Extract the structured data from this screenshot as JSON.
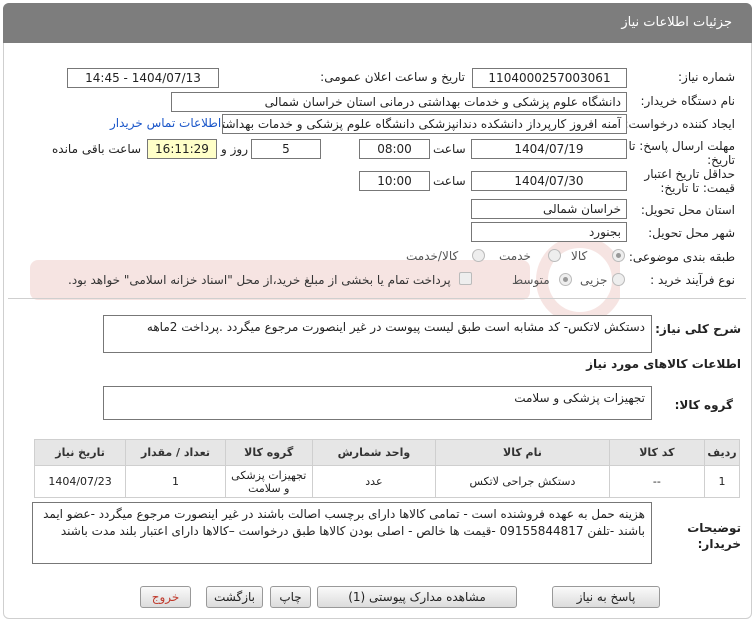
{
  "header": {
    "title": "جزئیات اطلاعات نیاز"
  },
  "fields": {
    "need_number_label": "شماره نیاز:",
    "need_number": "1104000257003061",
    "announce_label": "تاریخ و ساعت اعلان عمومی:",
    "announce_value": "1404/07/13 - 14:45",
    "buyer_org_label": "نام دستگاه خریدار:",
    "buyer_org": "دانشگاه علوم پزشکی و خدمات بهداشتی درمانی استان خراسان شمالی",
    "requester_label": "ایجاد کننده درخواست:",
    "requester": "آمنه افروز کارپرداز دانشکده دندانپزشکی دانشگاه علوم پزشکی و خدمات بهداشتی",
    "contact_link": "اطلاعات تماس خریدار",
    "deadline_label": "مهلت ارسال پاسخ: تا تاریخ:",
    "deadline_date": "1404/07/19",
    "time_label": "ساعت",
    "deadline_time": "08:00",
    "days_count": "5",
    "days_label": "روز و",
    "remaining_time": "16:11:29",
    "remaining_label": "ساعت باقی مانده",
    "validity_label": "حداقل تاریخ اعتبار قیمت: تا تاریخ:",
    "validity_date": "1404/07/30",
    "validity_time": "10:00",
    "province_label": "استان محل تحویل:",
    "province": "خراسان شمالی",
    "city_label": "شهر محل تحویل:",
    "city": "بجنورد",
    "category_label": "طبقه بندی موضوعی:",
    "category_options": [
      "کالا",
      "خدمت",
      "کالا/خدمت"
    ],
    "category_selected": "کالا",
    "process_label": "نوع فرآیند خرید :",
    "process_options": [
      "جزیی",
      "متوسط"
    ],
    "payment_note": "پرداخت تمام یا بخشی از مبلغ خرید،از محل \"اسناد خزانه اسلامی\" خواهد بود."
  },
  "description": {
    "label": "شرح کلی نیاز:",
    "text": "دستکش لاتکس- کد مشابه است طبق لیست پیوست در غیر اینصورت مرجوع میگردد .پرداخت 2ماهه"
  },
  "goods": {
    "section_title": "اطلاعات کالاهای مورد نیاز",
    "group_label": "گروه کالا:",
    "group_value": "تجهیزات پزشکی و سلامت"
  },
  "table": {
    "headers": [
      "ردیف",
      "کد کالا",
      "نام کالا",
      "واحد شمارش",
      "گروه کالا",
      "تعداد / مقدار",
      "تاریخ نیاز"
    ],
    "rows": [
      [
        "1",
        "--",
        "دستکش جراحی لاتکس",
        "عدد",
        "تجهیزات پزشکی و سلامت",
        "1",
        "1404/07/23"
      ]
    ]
  },
  "buyer_notes": {
    "label": "توضیحات خریدار:",
    "text": "هزینه حمل به عهده فروشنده است - تمامی کالاها دارای برچسب اصالت باشند در غیر اینصورت مرجوع میگردد -عضو ایمد باشند -تلفن 09155844817 -قیمت ها خالص - اصلی بودن کالاها طبق درخواست –کالاها دارای اعتبار بلند مدت باشند"
  },
  "buttons": {
    "reply": "پاسخ به نیاز",
    "attachments": "مشاهده مدارک پیوستی (1)",
    "print": "چاپ",
    "back": "بازگشت",
    "exit": "خروج"
  },
  "colors": {
    "header_bg": "#7d7d7d",
    "link": "#1a56c9",
    "highlight": "#ffffc8",
    "exit_text": "#c0392b"
  }
}
